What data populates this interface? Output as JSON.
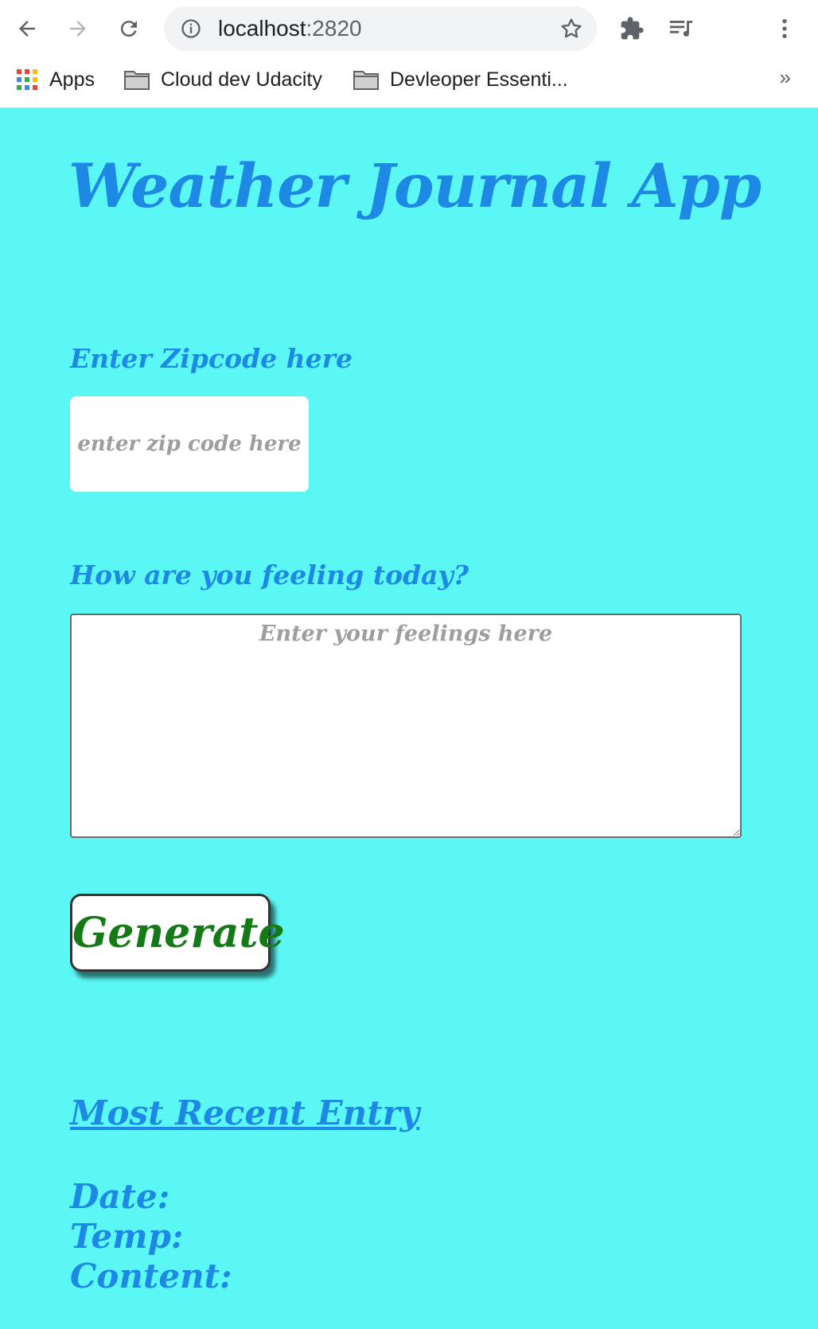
{
  "browser": {
    "url_host": "localhost",
    "url_port": ":2820",
    "bookmarks": [
      {
        "label": "Apps"
      },
      {
        "label": "Cloud dev Udacity"
      },
      {
        "label": "Devleoper Essenti..."
      }
    ],
    "more_label": "»"
  },
  "page": {
    "title": "Weather Journal App",
    "zip_label": "Enter Zipcode here",
    "zip_placeholder": "enter zip code here",
    "feelings_label": "How are you feeling today?",
    "feelings_placeholder": "Enter your feelings here",
    "generate_label": "Generate",
    "recent_heading": "Most Recent Entry",
    "date_label": "Date:",
    "temp_label": "Temp:",
    "content_label": "Content:"
  },
  "colors": {
    "background": "#5bf7f5",
    "heading": "#1e88e5",
    "button_text": "#137a16"
  }
}
